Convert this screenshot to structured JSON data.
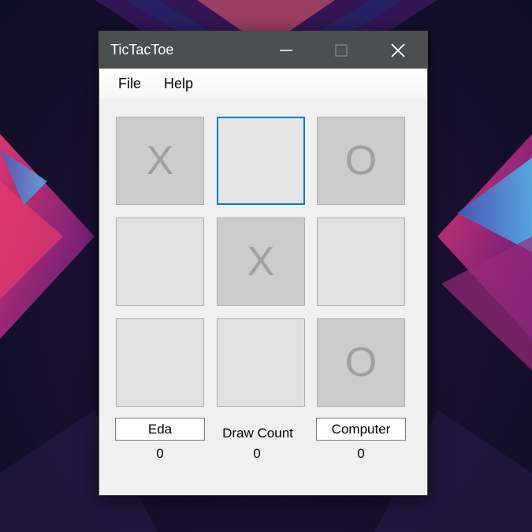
{
  "window": {
    "title": "TicTacToe"
  },
  "icons": {
    "minimize": "minimize-icon",
    "maximize": "maximize-icon",
    "close": "close-icon"
  },
  "menu": {
    "file": "File",
    "help": "Help"
  },
  "board": {
    "cells": [
      "X",
      "",
      "O",
      "",
      "X",
      "",
      "",
      "",
      "O"
    ],
    "focused_cell": 1
  },
  "scoreboard": {
    "player1_name": "Eda",
    "player1_score": "0",
    "draw_label": "Draw Count",
    "draw_score": "0",
    "player2_name": "Computer",
    "player2_score": "0"
  },
  "colors": {
    "titlebar": "#4a5050",
    "focus_accent": "#0078d7",
    "cell_filled": "#cccccc",
    "cell_empty": "#e1e1e1"
  }
}
